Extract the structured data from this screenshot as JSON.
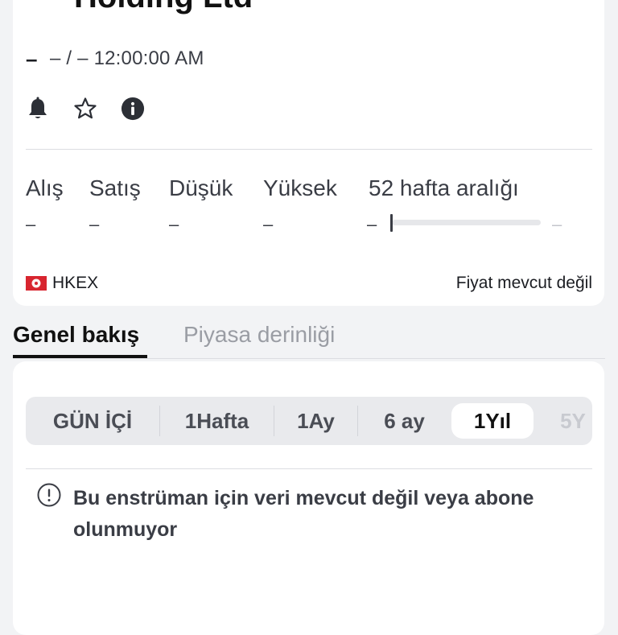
{
  "instrument": {
    "title": "Holding Ltd",
    "price": "–",
    "change_and_time": "– / –  12:00:00 AM"
  },
  "icons": {
    "alert": "bell-icon",
    "watchlist": "star-icon",
    "info": "info-icon"
  },
  "stats": [
    {
      "label": "Alış",
      "value": "–"
    },
    {
      "label": "Satış",
      "value": "–"
    },
    {
      "label": "Düşük",
      "value": "–"
    },
    {
      "label": "Yüksek",
      "value": "–"
    },
    {
      "label": "52 hafta aralığı",
      "low": "–",
      "high": "–"
    }
  ],
  "exchange": {
    "flag": "hong-kong-flag",
    "name": "HKEX",
    "price_status": "Fiyat mevcut değil"
  },
  "tabs": {
    "overview": "Genel bakış",
    "market_depth": "Piyasa derinliği"
  },
  "ranges": {
    "items": [
      "GÜN İÇİ",
      "1Hafta",
      "1Ay",
      "6 ay",
      "1Yıl",
      "5Y"
    ],
    "selected": "1Yıl"
  },
  "notice": {
    "text": "Bu enstrüman için veri mevcut değil veya abone olunmuyor"
  },
  "colors": {
    "background": "#f2f3f5",
    "card": "#ffffff",
    "text": "#1b1d22",
    "muted": "#9a9da4",
    "flag_red": "#d8252f"
  }
}
